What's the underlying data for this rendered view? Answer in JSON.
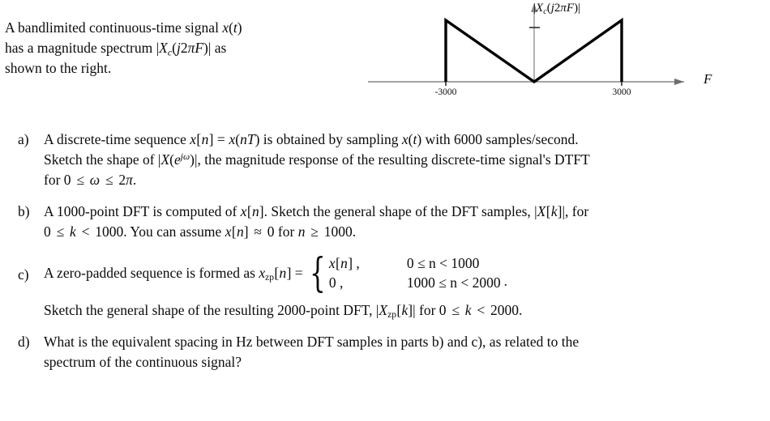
{
  "intro": {
    "line1_a": "A bandlimited continuous-time signal ",
    "line1_x": "x",
    "line1_b": "(",
    "line1_t": "t",
    "line1_c": ")",
    "line2_a": "has a magnitude spectrum |",
    "line2_X": "X",
    "line2_sub": "c",
    "line2_open": "(",
    "line2_j": "j",
    "line2_two": "2",
    "line2_pi": "π",
    "line2_F": "F",
    "line2_close": ")| as",
    "line3": "shown to the right."
  },
  "figure": {
    "title_bar_open": "|",
    "title_X": "X",
    "title_sub": "c",
    "title_paren_open": "(",
    "title_j": "j",
    "title_two": "2",
    "title_pi": "π",
    "title_F": "F",
    "title_close": ")|",
    "axis_label": "F",
    "tick_left": "-3000",
    "tick_right": "3000",
    "axis_color": "#6e6e6e",
    "curve_color": "#000000"
  },
  "chart_data": {
    "type": "line",
    "title": "|Xc(j2πF)|",
    "xlabel": "F",
    "ylabel": "|Xc(j2πF)|",
    "xlim": [
      -4200,
      4200
    ],
    "ylim": [
      0,
      1.12
    ],
    "xticks": [
      -3000,
      3000
    ],
    "xticklabels": [
      "-3000",
      "3000"
    ],
    "yticks": [
      0.72
    ],
    "yticklabels": [
      ""
    ],
    "grid": false,
    "legend": null,
    "description": "V-shaped (absolute-value) magnitude spectrum, zero at F=0, rising linearly to a peak at F=±3000, with vertical drops to zero at F=±3000.",
    "x": [
      -3000,
      -3000,
      0,
      3000,
      3000
    ],
    "y": [
      0,
      1.0,
      0,
      1.0,
      0
    ]
  },
  "problems": [
    {
      "marker": "a)",
      "id": "part-a",
      "text_plain": "A discrete-time sequence x[n] = x(nT) is obtained by sampling x(t) with 6000 samples/second. Sketch the shape of |X(e^{jω})|, the magnitude response of the resulting discrete-time signal's DTFT for 0 ≤ ω ≤ 2π.",
      "seg": {
        "s1": "A discrete-time sequence ",
        "x1": "x",
        "s2": "[",
        "n1": "n",
        "s3": "] = ",
        "x2": "x",
        "s4": "(",
        "n2": "n",
        "T": "T",
        "s5": ") is obtained by sampling ",
        "x3": "x",
        "s6": "(",
        "t1": "t",
        "s7": ") with 6000 samples/second.",
        "s8": "Sketch the shape of |",
        "X1": "X",
        "s9": "(",
        "e1": "e",
        "jw": "jω",
        "s10": ")|, the magnitude response of the resulting discrete-time signal's DTFT",
        "s11": "for 0 ",
        "le1": "≤",
        "w1": " ω ",
        "le2": "≤",
        "s12": " 2",
        "pi1": "π",
        "s13": "."
      }
    },
    {
      "marker": "b)",
      "id": "part-b",
      "text_plain": "A 1000-point DFT is computed of x[n]. Sketch the general shape of the DFT samples, |X[k]|, for 0 ≤ k < 1000. You can assume x[n] ≈ 0 for n ≥ 1000.",
      "seg": {
        "s1": "A 1000-point DFT is computed of ",
        "x1": "x",
        "s2": "[",
        "n1": "n",
        "s3": "]. Sketch the general shape of the DFT samples, |",
        "X1": "X",
        "s4": "[",
        "k1": "k",
        "s5": "]|, for",
        "s6": "0 ",
        "le1": "≤",
        "k2": " k ",
        "lt1": "<",
        "s7": " 1000. You can assume ",
        "x2": "x",
        "s8": "[",
        "n2": "n",
        "s9": "] ",
        "ap1": "≈",
        "s10": " 0 for ",
        "n3": "n",
        "ge1": " ≥ ",
        "s11": "1000."
      }
    },
    {
      "marker": "c)",
      "id": "part-c",
      "text_plain": "A zero-padded sequence is formed as x_zp[n] = { x[n], 0 ≤ n < 1000 ; 0, 1000 ≤ n < 2000 }.",
      "seg": {
        "s1": "A zero-padded sequence is formed as ",
        "x1": "x",
        "zp": "zp",
        "s2": "[",
        "n1": "n",
        "s3": "] =",
        "case1_val_x": "x",
        "case1_val_open": "[",
        "case1_val_n": "n",
        "case1_val_close": "] ,",
        "case1_cond": "0 ≤ n < 1000",
        "case2_val": "0 ,",
        "case2_cond": "1000 ≤ n < 2000",
        "period": "."
      }
    }
  ],
  "sketch_para": {
    "s1": "Sketch the general shape of the resulting 2000-point DFT, |",
    "X": "X",
    "zp": "zp",
    "s2": "[",
    "k": "k",
    "s3": "]| for 0 ",
    "le": "≤",
    "k2": " k ",
    "lt": "<",
    "s4": " 2000.",
    "text_plain": "Sketch the general shape of the resulting 2000-point DFT, |X_zp[k]| for 0 ≤ k < 2000."
  },
  "part_d": {
    "marker": "d)",
    "line1": "What is the equivalent spacing in Hz between DFT samples in parts b) and c), as related to the",
    "line2": "spectrum of the continuous signal?"
  }
}
